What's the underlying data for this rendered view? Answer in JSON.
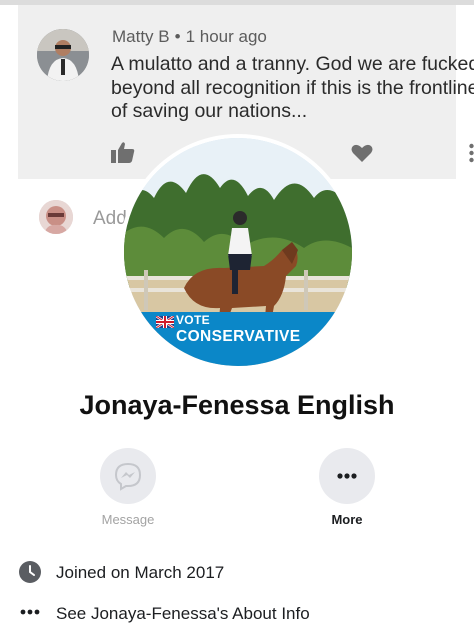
{
  "comment": {
    "author": "Matty B",
    "time": "1 hour ago",
    "separator": "•",
    "text": "A mulatto and a tranny. God we are fucked beyond all recognition if this is the frontline of saving our nations..."
  },
  "add_comment": {
    "placeholder": "Add"
  },
  "profile": {
    "name": "Jonaya-Fenessa English",
    "badge_line1": "VOTE",
    "badge_line2": "CONSERVATIVE"
  },
  "actions": {
    "message_label": "Message",
    "more_label": "More"
  },
  "info": {
    "joined": "Joined on March 2017",
    "about": "See Jonaya-Fenessa's About Info"
  },
  "colors": {
    "card_bg": "#efefef",
    "badge_blue": "#0b87c8",
    "button_bg": "#e9eaee",
    "icon_gray": "#6f6f6f"
  },
  "icons": [
    "like-icon",
    "heart-icon",
    "more-dots-icon",
    "messenger-icon",
    "more-horizontal-icon",
    "clock-icon",
    "dots-icon"
  ]
}
